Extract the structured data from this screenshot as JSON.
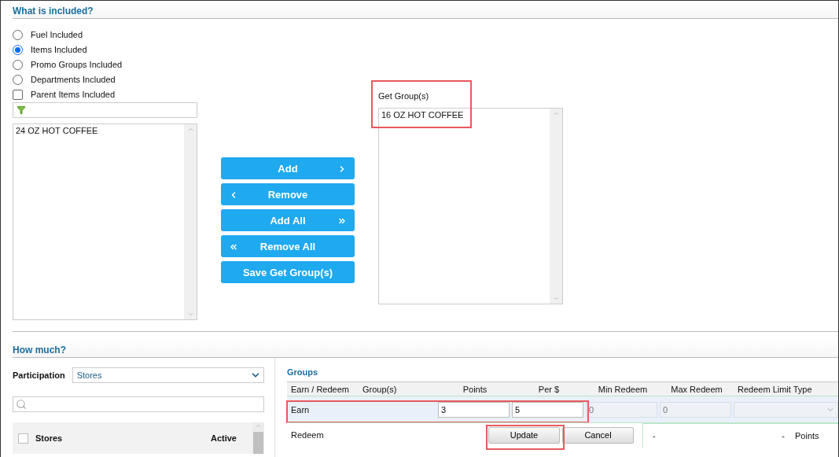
{
  "included": {
    "title": "What is included?",
    "options": [
      {
        "kind": "radio",
        "label": "Fuel Included",
        "selected": false
      },
      {
        "kind": "radio",
        "label": "Items Included",
        "selected": true
      },
      {
        "kind": "radio",
        "label": "Promo Groups Included",
        "selected": false
      },
      {
        "kind": "radio",
        "label": "Departments Included",
        "selected": false
      },
      {
        "kind": "checkbox",
        "label": "Parent Items Included",
        "checked": false
      }
    ],
    "available_items": [
      "24 OZ HOT COFFEE"
    ],
    "buttons": [
      {
        "label": "Add",
        "kind": "add"
      },
      {
        "label": "Remove",
        "kind": "remove"
      },
      {
        "label": "Add All",
        "kind": "add-all"
      },
      {
        "label": "Remove All",
        "kind": "remove-all"
      },
      {
        "label": "Save Get Group(s)",
        "kind": "save"
      }
    ],
    "get_groups": {
      "label": "Get Group(s)",
      "items": [
        "16 OZ HOT COFFEE"
      ]
    }
  },
  "how_much": {
    "title": "How much?",
    "participation": {
      "label": "Participation",
      "value": "Stores"
    },
    "stores_table": {
      "columns": [
        "Stores",
        "Active"
      ],
      "all_checked": false
    },
    "groups": {
      "title": "Groups",
      "columns": [
        "Earn / Redeem",
        "Group(s)",
        "Points",
        "Per $",
        "Min Redeem",
        "Max Redeem",
        "Redeem Limit Type"
      ],
      "earn_row": {
        "label": "Earn",
        "points": "3",
        "per_dollar": "5",
        "min_redeem_placeholder": "0",
        "max_redeem_placeholder": "0"
      },
      "redeem_row": {
        "label": "Redeem",
        "buttons": [
          "Update",
          "Cancel"
        ],
        "min_redeem": "-",
        "max_redeem": "-",
        "limit_type": "Points"
      }
    }
  }
}
